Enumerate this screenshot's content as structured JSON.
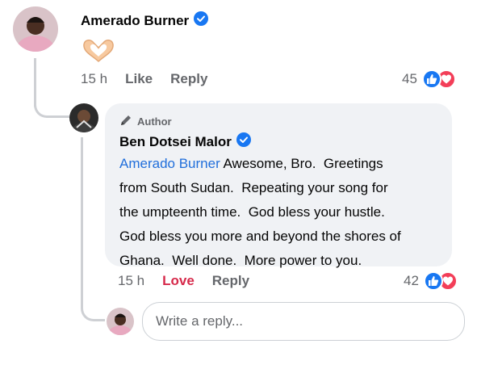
{
  "colors": {
    "text_primary": "#050505",
    "text_secondary": "#65676b",
    "link_blue": "#216fdb",
    "verified_blue": "#1877f2",
    "love_red": "#d6294a",
    "bubble_bg": "#f0f2f5",
    "thread_line": "#ced0d4"
  },
  "comment": {
    "author": "Amerado Burner",
    "verified": true,
    "emoji_icon": "heart-hands-icon",
    "time": "15 h",
    "like_label": "Like",
    "reply_label": "Reply",
    "reaction_count": "45",
    "reactions": [
      "like-reaction-icon",
      "love-reaction-icon"
    ]
  },
  "reply": {
    "badge": "Author",
    "badge_icon": "pen-icon",
    "author": "Ben Dotsei Malor",
    "verified": true,
    "mention": "Amerado Burner",
    "lines": [
      " Awesome, Bro.  Greetings",
      "from South Sudan.  Repeating your song for",
      "the umpteenth time.  God bless your hustle.",
      "God bless you more and beyond the shores of",
      "Ghana.  Well done.  More power to you."
    ],
    "time": "15 h",
    "love_label": "Love",
    "reply_label": "Reply",
    "reaction_count": "42",
    "reactions": [
      "like-reaction-icon",
      "love-reaction-icon"
    ]
  },
  "composer": {
    "placeholder": "Write a reply..."
  }
}
